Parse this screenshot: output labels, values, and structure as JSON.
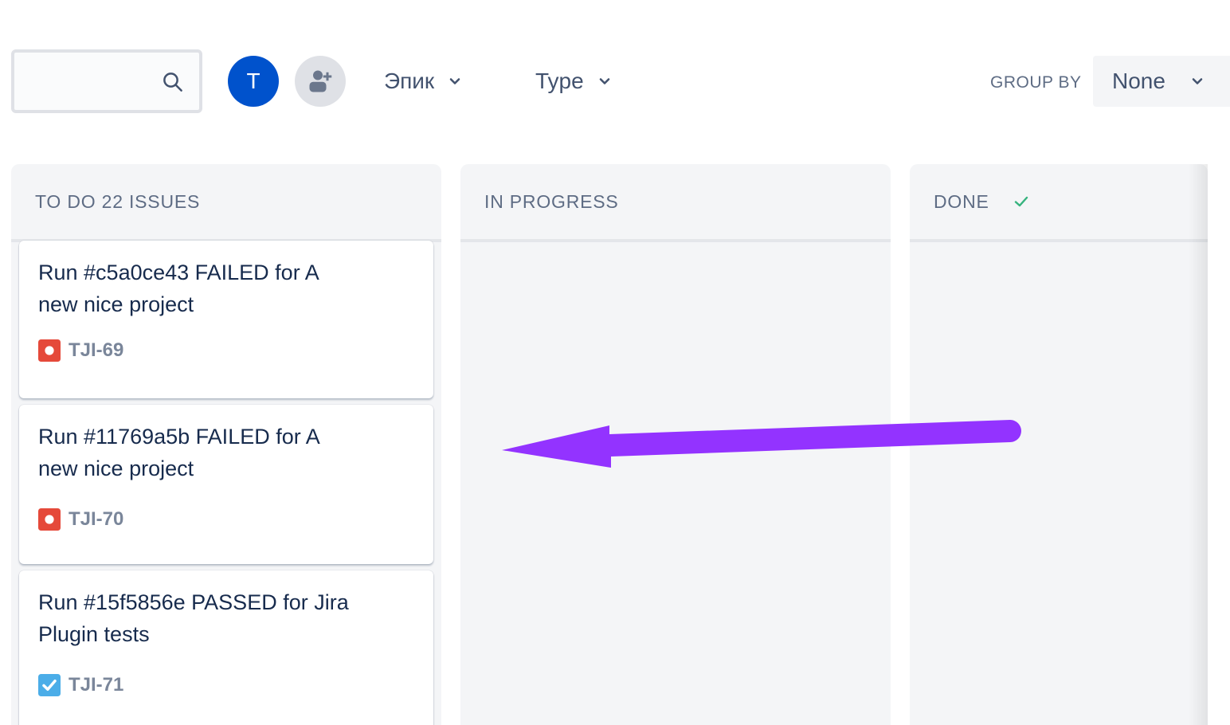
{
  "toolbar": {
    "search": {
      "value": "",
      "placeholder": "",
      "icon": "search-icon"
    },
    "avatar_initial": "T",
    "avatar_color": "#0052cc",
    "add_people_icon": "add-person-icon",
    "filters": [
      {
        "label": "Эпик",
        "icon": "chevron-down-icon"
      },
      {
        "label": "Type",
        "icon": "chevron-down-icon"
      }
    ],
    "group_by": {
      "label": "GROUP BY",
      "selected": "None",
      "icon": "chevron-down-icon"
    }
  },
  "board": {
    "columns": [
      {
        "title": "TO DO 22 ISSUES"
      },
      {
        "title": "IN PROGRESS"
      },
      {
        "title": "DONE",
        "icon": "check-icon",
        "icon_color": "#36b37e"
      }
    ],
    "cards": [
      {
        "title": "Run #c5a0ce43 FAILED for A new nice project",
        "key": "TJI-69",
        "type": "bug",
        "type_color": "#e5493a"
      },
      {
        "title": "Run #11769a5b FAILED for A new nice project",
        "key": "TJI-70",
        "type": "bug",
        "type_color": "#e5493a"
      },
      {
        "title": "Run #15f5856e PASSED for Jira Plugin tests",
        "key": "TJI-71",
        "type": "task",
        "type_color": "#4bade8"
      }
    ]
  },
  "annotation": {
    "arrow_color": "#9333ff",
    "arrow_icon": "left-arrow-annotation"
  }
}
